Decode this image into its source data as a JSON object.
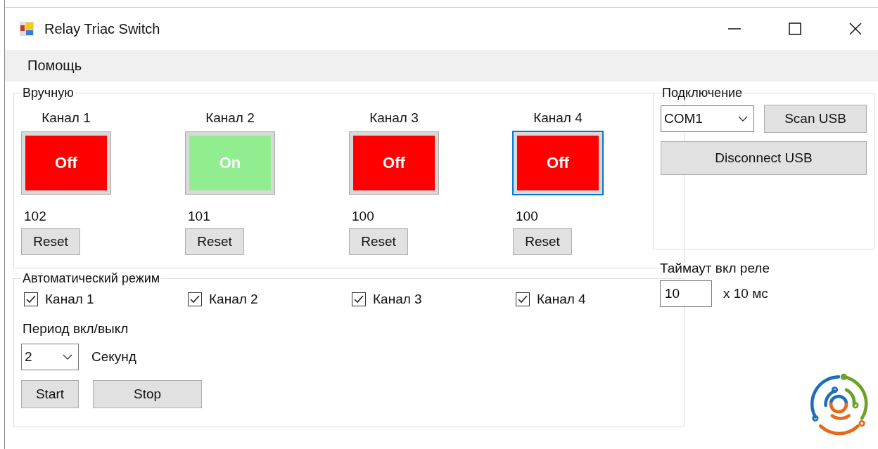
{
  "window": {
    "title": "Relay Triac Switch"
  },
  "menu": [
    "Помощь"
  ],
  "manual": {
    "title": "Вручную",
    "channels": [
      {
        "label": "Канал 1",
        "button": "Off",
        "on": false,
        "focused": false,
        "count": "102",
        "reset": "Reset"
      },
      {
        "label": "Канал 2",
        "button": "On",
        "on": true,
        "focused": false,
        "count": "101",
        "reset": "Reset"
      },
      {
        "label": "Канал 3",
        "button": "Off",
        "on": false,
        "focused": false,
        "count": "100",
        "reset": "Reset"
      },
      {
        "label": "Канал 4",
        "button": "Off",
        "on": false,
        "focused": true,
        "count": "100",
        "reset": "Reset"
      }
    ]
  },
  "auto": {
    "title": "Автоматический режим",
    "channels": [
      {
        "label": "Канал 1",
        "checked": true
      },
      {
        "label": "Канал 2",
        "checked": true
      },
      {
        "label": "Канал 3",
        "checked": true
      },
      {
        "label": "Канал 4",
        "checked": true
      }
    ],
    "period_label": "Период вкл/выкл",
    "period_value": "2",
    "period_unit": "Секунд",
    "start": "Start",
    "stop": "Stop"
  },
  "connection": {
    "title": "Подключение",
    "port": "COM1",
    "scan": "Scan USB",
    "disconnect": "Disconnect USB"
  },
  "timeout": {
    "label": "Таймаут вкл реле",
    "value": "10",
    "unit": "x 10 мс"
  }
}
